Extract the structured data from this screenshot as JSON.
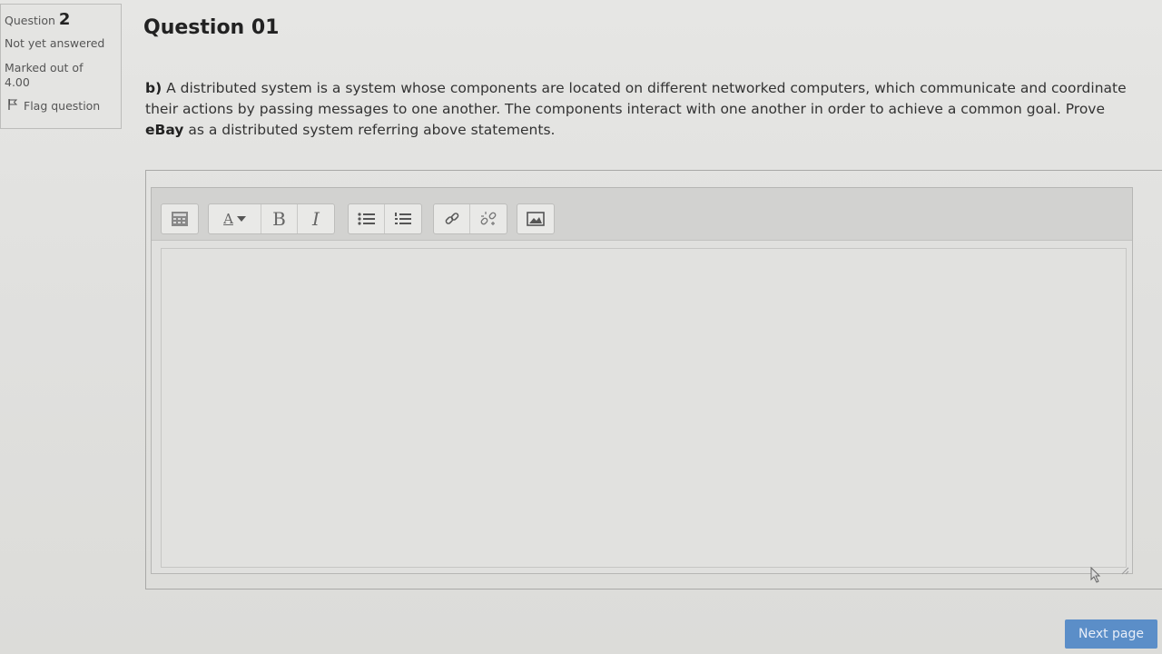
{
  "info": {
    "question_label": "Question",
    "question_number": "2",
    "state": "Not yet answered",
    "grade_label": "Marked out of",
    "grade_value": "4.00",
    "flag_label": "Flag question"
  },
  "question": {
    "title": "Question 01",
    "prefix": "b)",
    "text_part1": " A distributed system is a system whose components are located on different networked computers, which communicate and coordinate their actions by passing messages to one another. The components interact with one another in order to achieve a common goal. Prove ",
    "bold_word": "eBay",
    "text_part2": " as a distributed system referring above statements."
  },
  "editor": {
    "toolbar": [
      "toggle-toolbar-icon",
      "font-style-icon",
      "bold-icon",
      "italic-icon",
      "unordered-list-icon",
      "ordered-list-icon",
      "link-icon",
      "unlink-icon",
      "image-icon"
    ],
    "bold_glyph": "B",
    "italic_glyph": "I",
    "font_glyph": "A",
    "content": ""
  },
  "navigation": {
    "next_label": "Next page"
  },
  "colors": {
    "accent": "#5b8ec8",
    "background": "#e1e1df"
  }
}
